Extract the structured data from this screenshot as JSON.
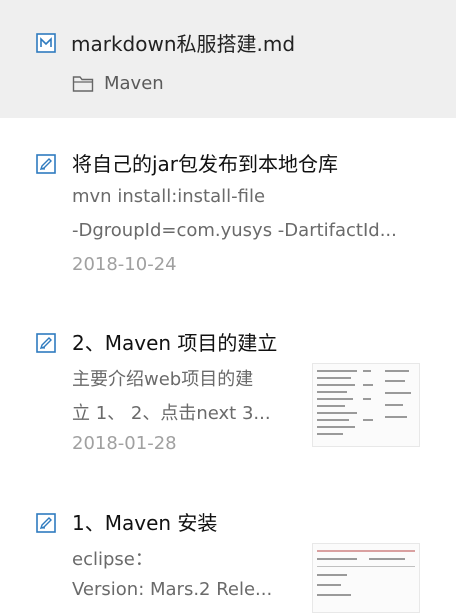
{
  "header": {
    "file_title": "markdown私服搭建.md",
    "folder_label": "Maven"
  },
  "notes": [
    {
      "title": "将自己的jar包发布到本地仓库",
      "line1": "mvn install:install-file",
      "line2": "-DgroupId=com.yusys -DartifactId...",
      "date": "2018-10-24"
    },
    {
      "title": "2、Maven 项目的建立",
      "line1": "主要介绍web项目的建",
      "line2": "立 1、 2、点击next 3...",
      "date": "2018-01-28"
    },
    {
      "title": "1、Maven 安装",
      "line1": "eclipse：",
      "line2": "Version: Mars.2 Rele..."
    }
  ],
  "colors": {
    "icon_blue": "#2f7bbf",
    "header_bg": "#efefef"
  },
  "icons": {
    "file": "markdown-file-icon",
    "folder": "folder-icon",
    "note": "note-edit-icon"
  }
}
